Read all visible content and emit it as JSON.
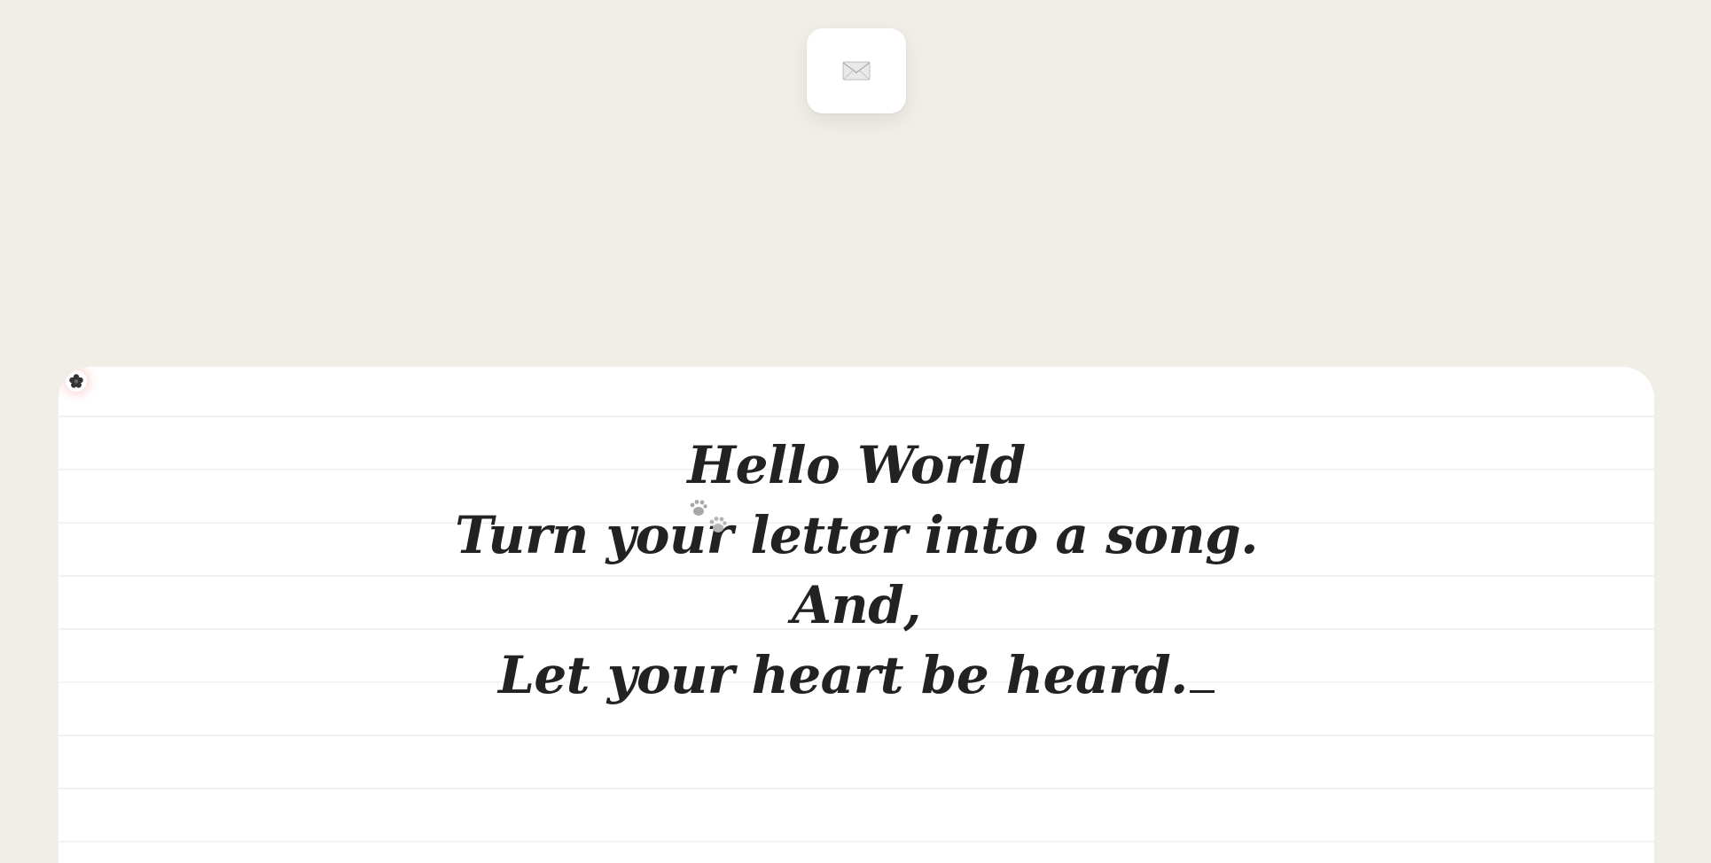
{
  "toolbar": {
    "envelope_icon": "envelope-icon"
  },
  "paper": {
    "decoration_icon": "flower-icon",
    "paw_icon": "paw-prints-icon"
  },
  "letter": {
    "lines": [
      "Hello World",
      "Turn your letter into a song.",
      "And,",
      "Let your heart be heard."
    ],
    "cursor": "_"
  },
  "colors": {
    "background": "#f1eee7",
    "paper": "#ffffff",
    "ink": "#222222",
    "rule_lines": "#f2f1ef"
  }
}
